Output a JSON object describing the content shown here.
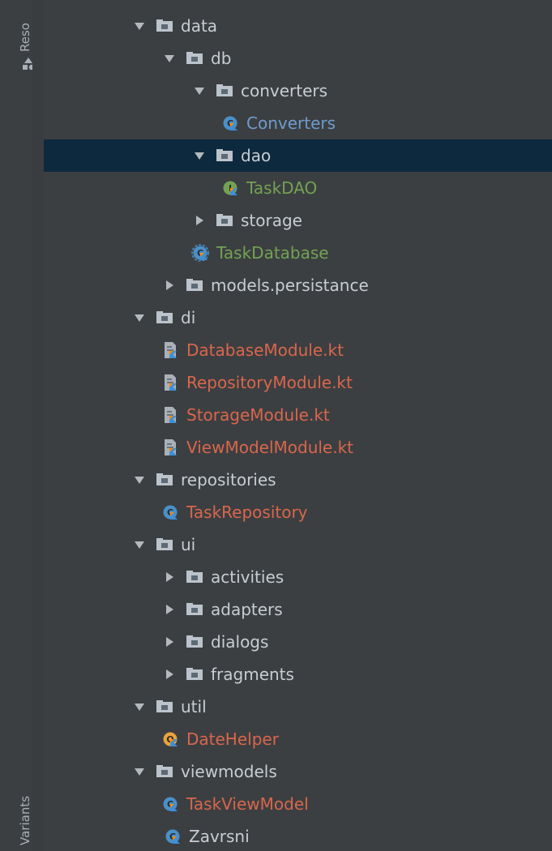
{
  "stripe": {
    "top_label": "Reso",
    "bottom_label": "Variants",
    "top_icon": "resource-manager-icon"
  },
  "tree": {
    "items": [
      {
        "label": "data",
        "depth": 0,
        "type": "folder",
        "expanded": true,
        "color": "#c7cdd3"
      },
      {
        "label": "db",
        "depth": 1,
        "type": "folder",
        "expanded": true,
        "color": "#c7cdd3"
      },
      {
        "label": "converters",
        "depth": 2,
        "type": "folder",
        "expanded": true,
        "color": "#c7cdd3"
      },
      {
        "label": "Converters",
        "depth": 3,
        "type": "kotlin-class",
        "color": "#6e9ccc"
      },
      {
        "label": "dao",
        "depth": 2,
        "type": "folder",
        "expanded": true,
        "selected": true,
        "color": "#c7cdd3"
      },
      {
        "label": "TaskDAO",
        "depth": 3,
        "type": "kotlin-interface",
        "color": "#73a254"
      },
      {
        "label": "storage",
        "depth": 2,
        "type": "folder",
        "expanded": false,
        "color": "#c7cdd3"
      },
      {
        "label": "TaskDatabase",
        "depth": 2,
        "type": "kotlin-abstract-class",
        "color": "#73a254"
      },
      {
        "label": "models.persistance",
        "depth": 1,
        "type": "folder",
        "expanded": false,
        "color": "#c7cdd3"
      },
      {
        "label": "di",
        "depth": 0,
        "type": "folder",
        "expanded": true,
        "color": "#c7cdd3"
      },
      {
        "label": "DatabaseModule.kt",
        "depth": 1,
        "type": "kotlin-file",
        "color": "#d9664d"
      },
      {
        "label": "RepositoryModule.kt",
        "depth": 1,
        "type": "kotlin-file",
        "color": "#d9664d"
      },
      {
        "label": "StorageModule.kt",
        "depth": 1,
        "type": "kotlin-file",
        "color": "#d9664d"
      },
      {
        "label": "ViewModelModule.kt",
        "depth": 1,
        "type": "kotlin-file",
        "color": "#d9664d"
      },
      {
        "label": "repositories",
        "depth": 0,
        "type": "folder",
        "expanded": true,
        "color": "#c7cdd3"
      },
      {
        "label": "TaskRepository",
        "depth": 1,
        "type": "kotlin-class",
        "color": "#d9664d"
      },
      {
        "label": "ui",
        "depth": 0,
        "type": "folder",
        "expanded": true,
        "color": "#c7cdd3"
      },
      {
        "label": "activities",
        "depth": 1,
        "type": "folder",
        "expanded": false,
        "color": "#c7cdd3"
      },
      {
        "label": "adapters",
        "depth": 1,
        "type": "folder",
        "expanded": false,
        "color": "#c7cdd3"
      },
      {
        "label": "dialogs",
        "depth": 1,
        "type": "folder",
        "expanded": false,
        "color": "#c7cdd3"
      },
      {
        "label": "fragments",
        "depth": 1,
        "type": "folder",
        "expanded": false,
        "color": "#c7cdd3"
      },
      {
        "label": "util",
        "depth": 0,
        "type": "folder",
        "expanded": true,
        "color": "#c7cdd3"
      },
      {
        "label": "DateHelper",
        "depth": 1,
        "type": "kotlin-object",
        "color": "#d9664d"
      },
      {
        "label": "viewmodels",
        "depth": 0,
        "type": "folder",
        "expanded": true,
        "color": "#c7cdd3"
      },
      {
        "label": "TaskViewModel",
        "depth": 1,
        "type": "kotlin-class",
        "color": "#d9664d"
      },
      {
        "label": "Zavrsni",
        "depth": 0,
        "type": "kotlin-class",
        "noarrow": true,
        "color": "#c7cdd3"
      }
    ]
  }
}
